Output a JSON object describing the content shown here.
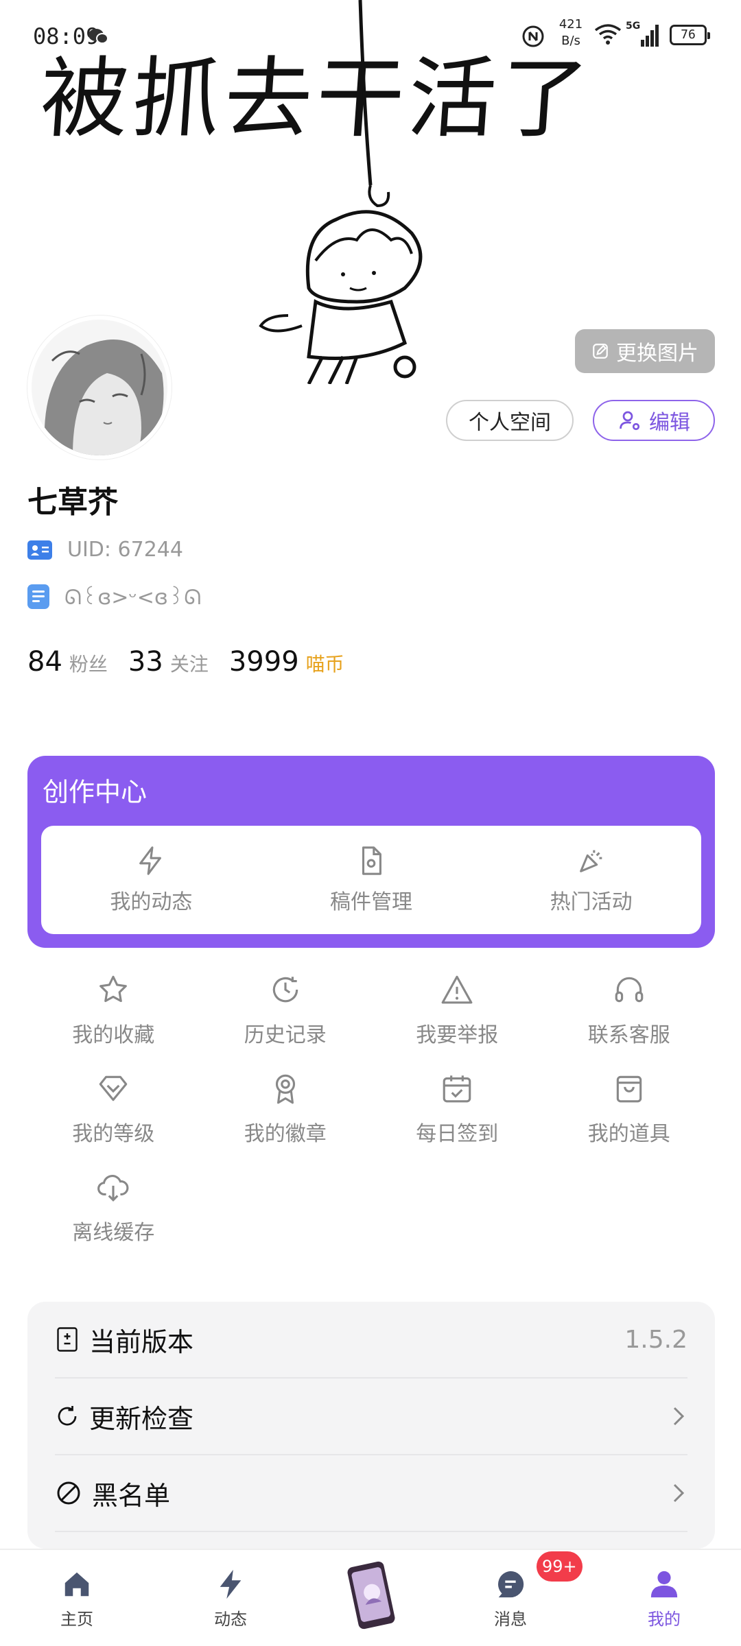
{
  "status_bar": {
    "time": "08:09",
    "net_speed_value": "421",
    "net_speed_unit": "B/s",
    "network": "5G",
    "battery": "76"
  },
  "cover": {
    "caption": "被抓去干活了",
    "change_button": "更换图片"
  },
  "profile": {
    "space_button": "个人空间",
    "edit_button": "编辑",
    "name": "七草芥",
    "uid": "UID: 67244",
    "signature": "ᘏ꒰ɞ>ᵕ<ɞ꒱ᘏ",
    "stats": [
      {
        "value": "84",
        "label": "粉丝"
      },
      {
        "value": "33",
        "label": "关注"
      },
      {
        "value": "3999",
        "label": "喵币"
      }
    ]
  },
  "creator_center": {
    "title": "创作中心",
    "items": [
      {
        "label": "我的动态",
        "icon": "lightning-icon"
      },
      {
        "label": "稿件管理",
        "icon": "file-settings-icon"
      },
      {
        "label": "热门活动",
        "icon": "party-popper-icon"
      }
    ]
  },
  "menu": {
    "items": [
      {
        "label": "我的收藏",
        "icon": "star-icon"
      },
      {
        "label": "历史记录",
        "icon": "history-icon"
      },
      {
        "label": "我要举报",
        "icon": "warning-icon"
      },
      {
        "label": "联系客服",
        "icon": "headset-icon"
      },
      {
        "label": "我的等级",
        "icon": "diamond-icon"
      },
      {
        "label": "我的徽章",
        "icon": "medal-icon"
      },
      {
        "label": "每日签到",
        "icon": "calendar-check-icon"
      },
      {
        "label": "我的道具",
        "icon": "shopping-bag-icon"
      },
      {
        "label": "离线缓存",
        "icon": "cloud-download-icon"
      }
    ]
  },
  "settings": {
    "version_label": "当前版本",
    "version_value": "1.5.2",
    "update_label": "更新检查",
    "blacklist_label": "黑名单"
  },
  "tabbar": {
    "tabs": [
      {
        "label": "主页",
        "icon": "home-icon"
      },
      {
        "label": "动态",
        "icon": "lightning-icon"
      },
      {
        "label": "",
        "icon": "phone-center-icon"
      },
      {
        "label": "消息",
        "icon": "message-icon"
      },
      {
        "label": "我的",
        "icon": "user-icon"
      }
    ],
    "message_badge": "99+",
    "active_color": "#7c55e0"
  },
  "colors": {
    "accent": "#8b5cf0",
    "coin": "#e7a21d",
    "badge": "#f23c4a"
  }
}
